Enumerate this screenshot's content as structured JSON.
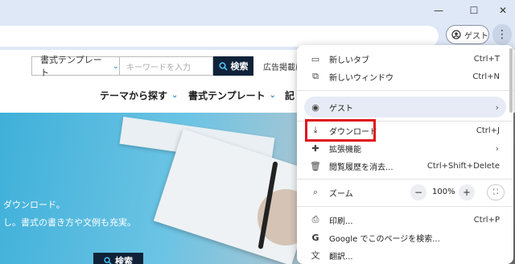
{
  "window": {
    "minimize_glyph": "—",
    "maximize_glyph": "☐",
    "close_glyph": "✕"
  },
  "toolbar": {
    "profile_label": "ゲスト",
    "profile_icon": "person-circle-icon",
    "menu_icon": "kebab-icon"
  },
  "site": {
    "category_select": "書式テンプレート",
    "keyword_placeholder": "キーワードを入力",
    "search_button": "検索",
    "ad_notice": "広告掲載に",
    "nav": [
      {
        "label": "テーマから探す"
      },
      {
        "label": "書式テンプレート"
      },
      {
        "label": "記"
      }
    ],
    "hero_line1": "ダウンロード。",
    "hero_line2": "し。書式の書き方や文例も充実。",
    "hero_search_button": "検索"
  },
  "menu": {
    "items": {
      "new_tab": {
        "label": "新しいタブ",
        "shortcut": "Ctrl+T",
        "icon": "new-tab-icon"
      },
      "new_window": {
        "label": "新しいウィンドウ",
        "shortcut": "Ctrl+N",
        "icon": "new-window-icon"
      },
      "guest": {
        "label": "ゲスト",
        "icon": "person-circle-icon"
      },
      "downloads": {
        "label": "ダウンロード",
        "shortcut": "Ctrl+J",
        "icon": "download-icon"
      },
      "extensions": {
        "label": "拡張機能",
        "icon": "puzzle-icon"
      },
      "clear_history": {
        "label": "閲覧履歴を消去...",
        "shortcut": "Ctrl+Shift+Delete",
        "icon": "trash-icon"
      },
      "zoom": {
        "label": "ズーム",
        "value": "100%",
        "icon": "zoom-icon"
      },
      "print": {
        "label": "印刷...",
        "shortcut": "Ctrl+P",
        "icon": "printer-icon"
      },
      "google_search": {
        "label": "Google でこのページを検索...",
        "icon": "google-icon"
      },
      "translate": {
        "label": "翻訳...",
        "icon": "translate-icon"
      }
    }
  },
  "colors": {
    "highlight": "#e0141a",
    "accent": "#1e88c8",
    "site_dark": "#0f2238"
  }
}
